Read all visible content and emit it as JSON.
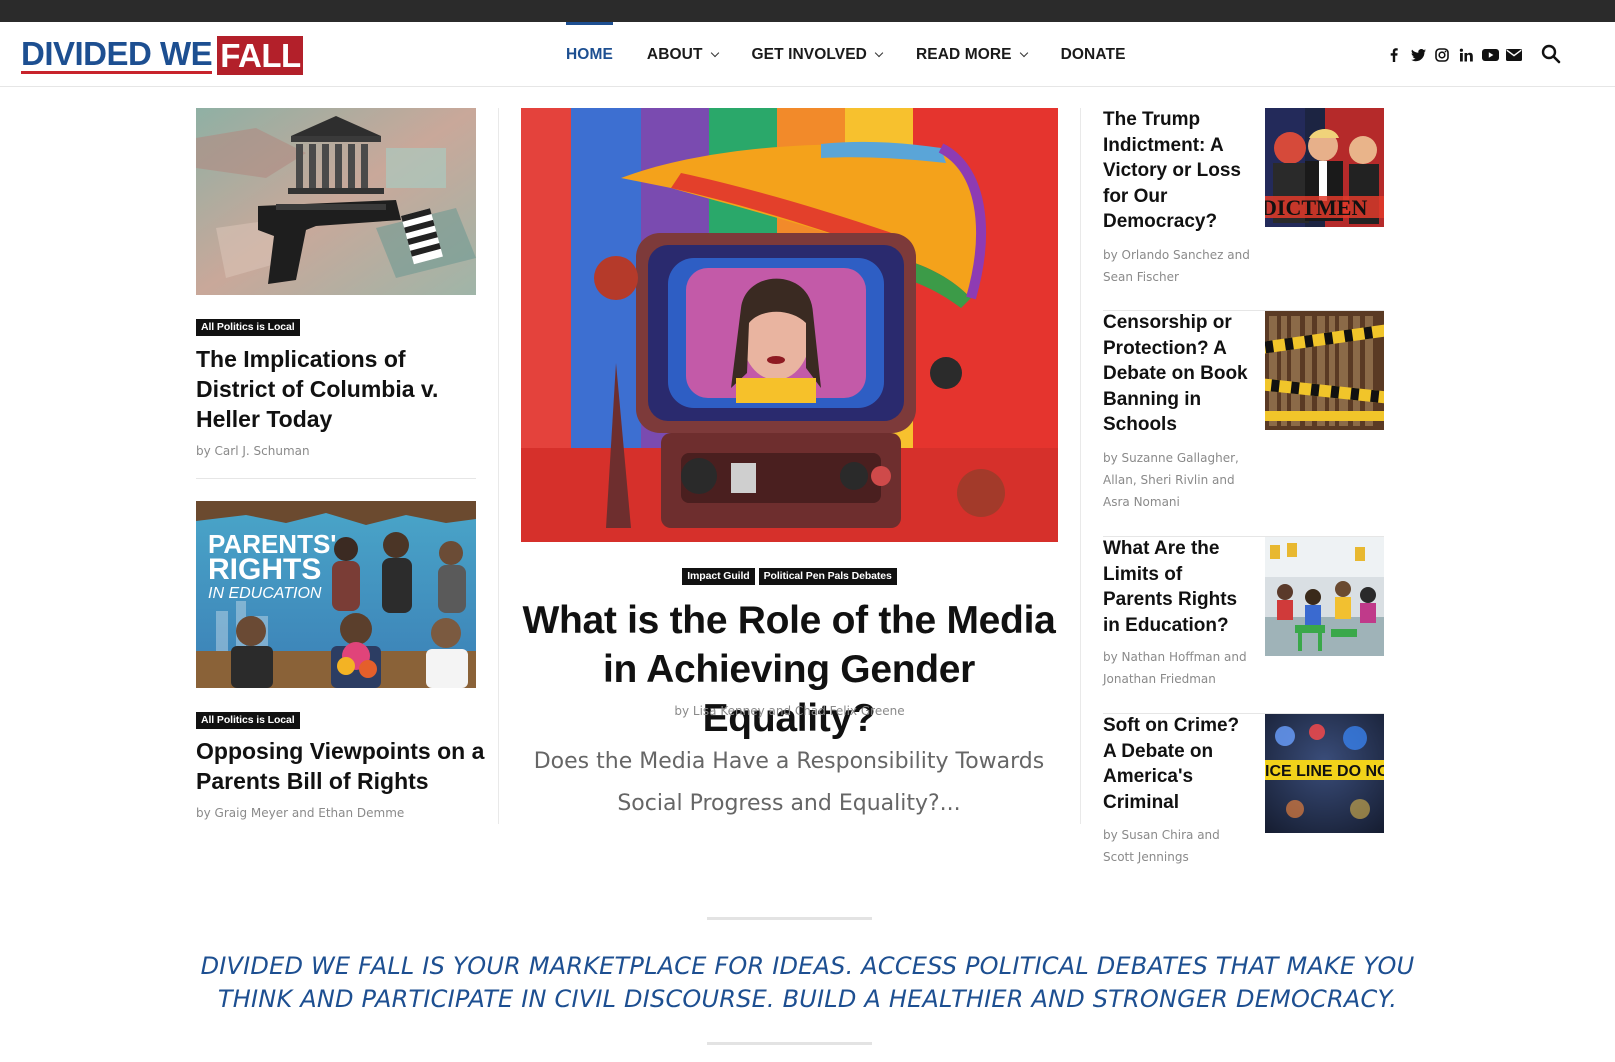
{
  "brand": {
    "logo_part1": "DIVIDED WE",
    "logo_part2": "FALL"
  },
  "nav": {
    "items": [
      {
        "label": "HOME",
        "active": true,
        "dropdown": false
      },
      {
        "label": "ABOUT",
        "active": false,
        "dropdown": true
      },
      {
        "label": "GET INVOLVED",
        "active": false,
        "dropdown": true
      },
      {
        "label": "READ MORE",
        "active": false,
        "dropdown": true
      },
      {
        "label": "DONATE",
        "active": false,
        "dropdown": false
      }
    ],
    "social_icons": [
      "facebook-icon",
      "twitter-icon",
      "instagram-icon",
      "linkedin-icon",
      "youtube-icon",
      "email-icon"
    ],
    "search_icon": "search-icon"
  },
  "left_articles": [
    {
      "category": "All Politics is Local",
      "title": "The Implications of District of Columbia v. Heller Today",
      "byline": "by Carl J. Schuman"
    },
    {
      "category": "All Politics is Local",
      "title": "Opposing Viewpoints on a Parents Bill of Rights",
      "byline": "by Graig Meyer and Ethan Demme",
      "image_text": {
        "line1": "PARENTS'",
        "line2": "RIGHTS",
        "line3": "IN EDUCATION"
      }
    }
  ],
  "featured": {
    "categories": [
      "Impact Guild",
      "Political Pen Pals Debates"
    ],
    "title": "What is the Role of the Media in Achieving Gender Equality?",
    "byline": "by Lisa Kenney and Chad Felix Greene",
    "excerpt": "Does the Media Have a Responsibility Towards Social Progress and Equality?..."
  },
  "right_articles": [
    {
      "title": "The Trump Indictment: A Victory or Loss for Our Democracy?",
      "byline": "by Orlando Sanchez and Sean Fischer",
      "image_text": "DICTMEN"
    },
    {
      "title": "Censorship or Protection? A Debate on Book Banning in Schools",
      "byline": "by Suzanne Gallagher, Allan, Sheri Rivlin and Asra Nomani"
    },
    {
      "title": "What Are the Limits of Parents Rights in Education?",
      "byline": "by Nathan Hoffman and Jonathan Friedman"
    },
    {
      "title": "Soft on Crime? A Debate on America's Criminal",
      "byline": "by Susan Chira and Scott Jennings",
      "image_text": "ICE LINE DO NOT CR"
    }
  ],
  "tagline": "DIVIDED WE FALL IS YOUR MARKETPLACE FOR IDEAS. ACCESS POLITICAL DEBATES THAT MAKE YOU THINK AND PARTICIPATE IN CIVIL DISCOURSE. BUILD A HEALTHIER AND STRONGER DEMOCRACY.",
  "colors": {
    "brand_blue": "#1d4f91",
    "brand_red": "#b3202a",
    "tag_bg": "#111111",
    "muted_text": "#8a8a8a"
  }
}
